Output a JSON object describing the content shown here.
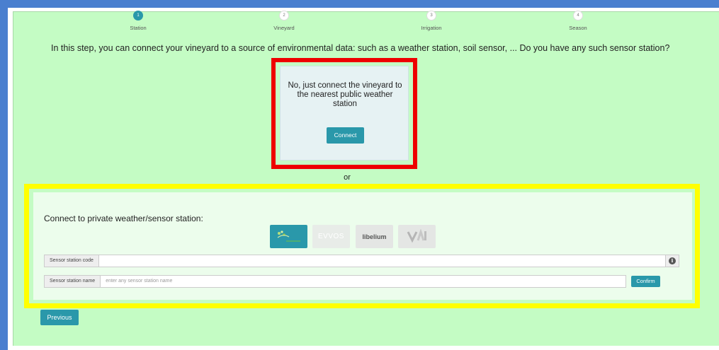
{
  "steps": [
    {
      "number": "1",
      "label": "Station",
      "active": true
    },
    {
      "number": "2",
      "label": "Vineyard",
      "active": false
    },
    {
      "number": "3",
      "label": "Irrigation",
      "active": false
    },
    {
      "number": "4",
      "label": "Season",
      "active": false
    }
  ],
  "intro_text": "In this step, you can connect your vineyard to a source of environmental data: such as a weather station, soil sensor, ... Do you have any such sensor station?",
  "public_option": {
    "message": "No, just connect the vineyard to the nearest public weather station",
    "button_label": "Connect"
  },
  "or_label": "or",
  "private_option": {
    "title": "Connect to private weather/sensor station:",
    "providers": [
      {
        "text": "",
        "selected": true
      },
      {
        "text": "EVVOS",
        "selected": false
      },
      {
        "text": "libelium",
        "selected": false
      },
      {
        "text": "",
        "selected": false
      }
    ],
    "station_code_label": "Sensor station code",
    "station_code_value": "",
    "station_name_label": "Sensor station name",
    "station_name_placeholder": "enter any sensor station name",
    "confirm_label": "Confirm"
  },
  "previous_label": "Previous",
  "colors": {
    "frame": "#4a7fcf",
    "page_background": "#c4fcc4",
    "accent": "#2a98aa",
    "red_highlight": "#ee0000",
    "yellow_highlight": "#ffff00"
  }
}
